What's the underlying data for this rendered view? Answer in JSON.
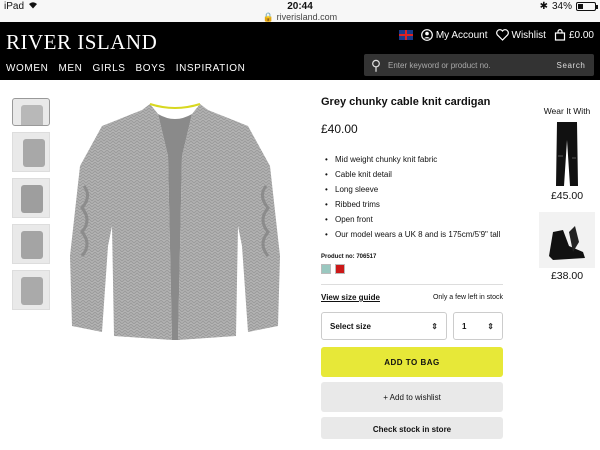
{
  "status_bar": {
    "device": "iPad",
    "time": "20:44",
    "url": "riverisland.com",
    "battery": "34%",
    "battery_level": 0.34
  },
  "header": {
    "logo": "RIVER ISLAND",
    "nav": [
      "WOMEN",
      "MEN",
      "GIRLS",
      "BOYS",
      "INSPIRATION"
    ],
    "account_label": "My Account",
    "wishlist_label": "Wishlist",
    "bag_label": "£0.00",
    "search_placeholder": "Enter keyword or product no.",
    "search_button": "Search"
  },
  "product": {
    "title": "Grey chunky cable knit cardigan",
    "price": "£40.00",
    "features": [
      "Mid weight chunky knit fabric",
      "Cable knit detail",
      "Long sleeve",
      "Ribbed trims",
      "Open front",
      "Our model wears a UK 8 and is 175cm/5'9\" tall"
    ],
    "product_no": "Product no: 706517",
    "swatch_colors": [
      "#9ac8c0",
      "#cc1818"
    ],
    "size_guide": "View size guide",
    "stock_note": "Only a few left in stock",
    "size_select": "Select size",
    "qty_select": "1",
    "add_to_bag": "ADD TO BAG",
    "add_to_wishlist": "+ Add to wishlist",
    "check_stock": "Check stock in store"
  },
  "wear_it_with": {
    "title": "Wear It With",
    "items": [
      {
        "name": "black-jeans",
        "price": "£45.00"
      },
      {
        "name": "black-sandals",
        "price": "£38.00"
      }
    ]
  },
  "colors": {
    "header_bg": "#000000",
    "bag_button": "#e7e838"
  }
}
